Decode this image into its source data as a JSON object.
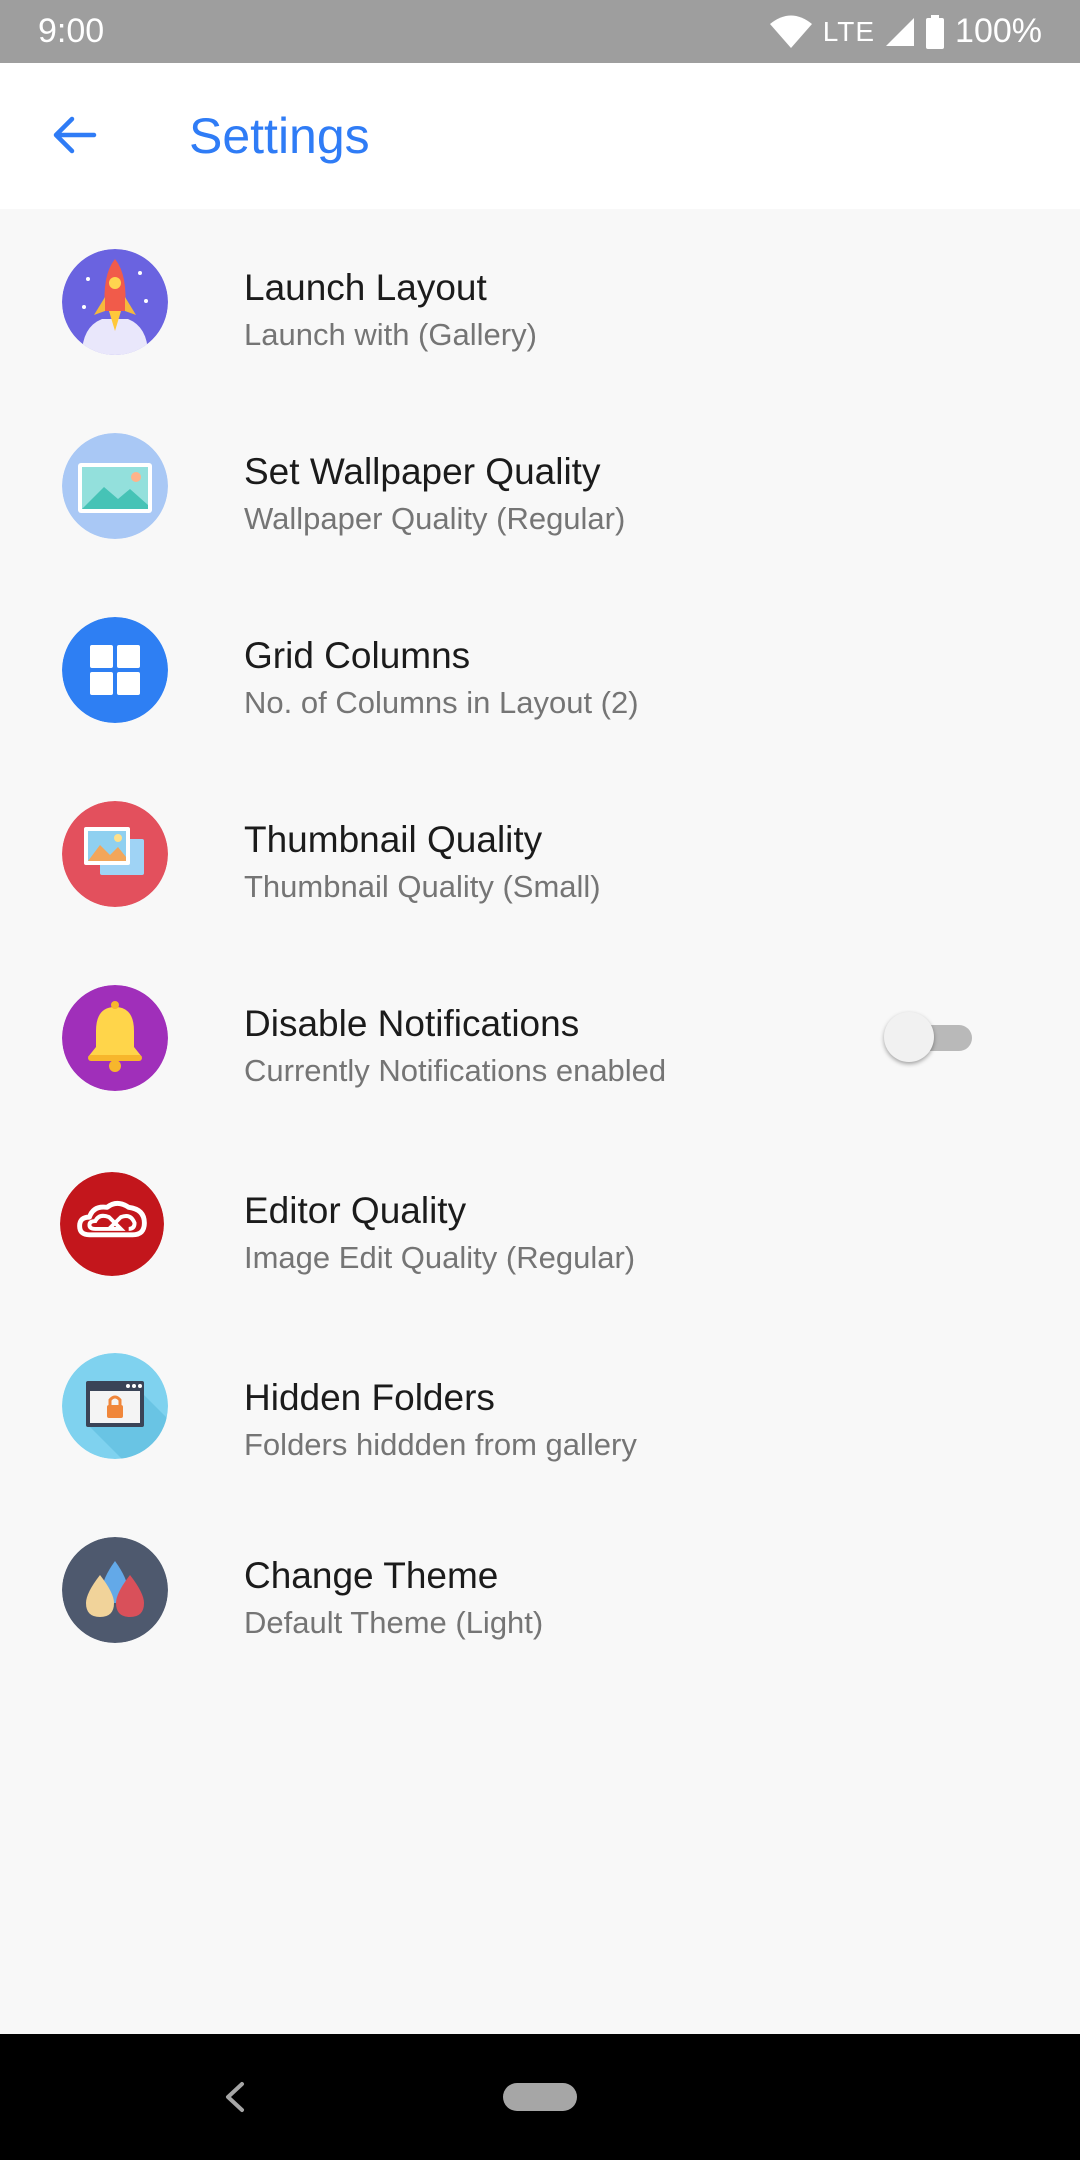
{
  "status_bar": {
    "time": "9:00",
    "network": "LTE",
    "battery": "100%",
    "icons": [
      "wifi-icon",
      "signal-icon",
      "battery-icon"
    ]
  },
  "app_bar": {
    "back_icon": "arrow-back-icon",
    "title": "Settings",
    "accent_color": "#2f7cf6"
  },
  "settings": [
    {
      "title": "Launch Layout",
      "subtitle": "Launch with (Gallery)",
      "icon": "rocket-icon"
    },
    {
      "title": "Set Wallpaper Quality",
      "subtitle": "Wallpaper Quality (Regular)",
      "icon": "wallpaper-icon"
    },
    {
      "title": "Grid Columns",
      "subtitle": "No. of Columns in Layout (2)",
      "icon": "grid-icon"
    },
    {
      "title": "Thumbnail Quality",
      "subtitle": "Thumbnail Quality (Small)",
      "icon": "thumbnail-icon"
    },
    {
      "title": "Disable Notifications",
      "subtitle": "Currently Notifications enabled",
      "icon": "bell-icon",
      "toggle_on": false
    },
    {
      "title": "Editor Quality",
      "subtitle": "Image Edit Quality (Regular)",
      "icon": "creative-cloud-icon"
    },
    {
      "title": "Hidden Folders",
      "subtitle": "Folders hiddden from gallery",
      "icon": "locked-window-icon"
    },
    {
      "title": "Change Theme",
      "subtitle": "Default Theme (Light)",
      "icon": "color-drops-icon"
    }
  ],
  "nav_bar": {
    "icons": [
      "nav-back-icon",
      "home-pill-icon"
    ]
  }
}
